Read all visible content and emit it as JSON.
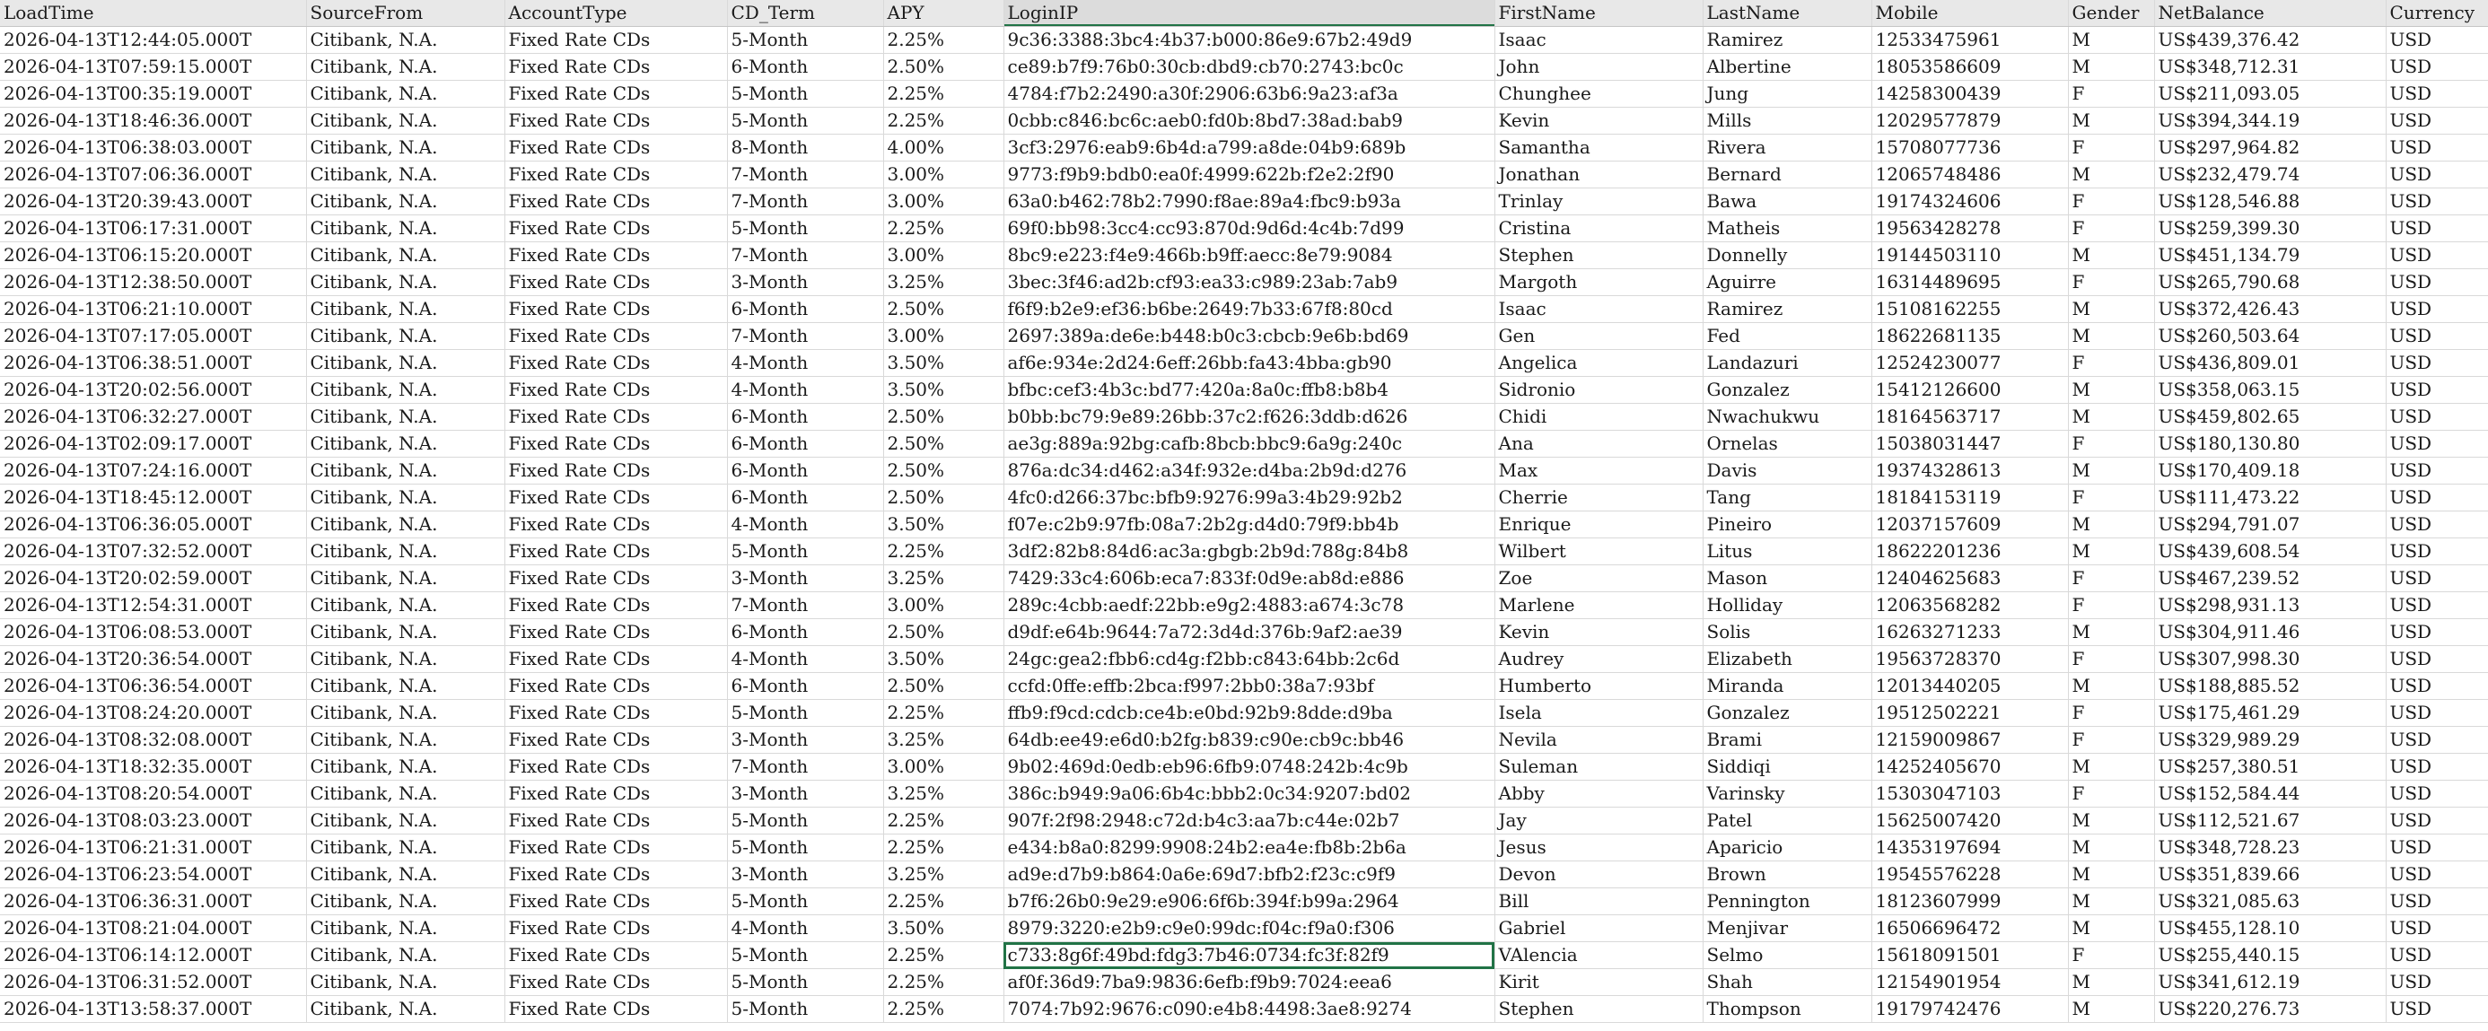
{
  "sheet": {
    "active_column": "LoginIP",
    "selected_row_index": 34,
    "columns": [
      {
        "key": "LoadTime",
        "label": "LoadTime"
      },
      {
        "key": "SourceFrom",
        "label": "SourceFrom"
      },
      {
        "key": "AccountType",
        "label": "AccountType"
      },
      {
        "key": "CD_Term",
        "label": "CD_Term"
      },
      {
        "key": "APY",
        "label": "APY"
      },
      {
        "key": "LoginIP",
        "label": "LoginIP"
      },
      {
        "key": "FirstName",
        "label": "FirstName"
      },
      {
        "key": "LastName",
        "label": "LastName"
      },
      {
        "key": "Mobile",
        "label": "Mobile"
      },
      {
        "key": "Gender",
        "label": "Gender"
      },
      {
        "key": "NetBalance",
        "label": "NetBalance"
      },
      {
        "key": "Currency",
        "label": "Currency"
      }
    ],
    "rows": [
      [
        "2026-04-13T12:44:05.000T",
        "Citibank, N.A.",
        "Fixed Rate CDs",
        "5-Month",
        "2.25%",
        "9c36:3388:3bc4:4b37:b000:86e9:67b2:49d9",
        "Isaac",
        "Ramirez",
        "12533475961",
        "M",
        "US$439,376.42",
        "USD"
      ],
      [
        "2026-04-13T07:59:15.000T",
        "Citibank, N.A.",
        "Fixed Rate CDs",
        "6-Month",
        "2.50%",
        "ce89:b7f9:76b0:30cb:dbd9:cb70:2743:bc0c",
        "John",
        "Albertine",
        "18053586609",
        "M",
        "US$348,712.31",
        "USD"
      ],
      [
        "2026-04-13T00:35:19.000T",
        "Citibank, N.A.",
        "Fixed Rate CDs",
        "5-Month",
        "2.25%",
        "4784:f7b2:2490:a30f:2906:63b6:9a23:af3a",
        "Chunghee",
        "Jung",
        "14258300439",
        "F",
        "US$211,093.05",
        "USD"
      ],
      [
        "2026-04-13T18:46:36.000T",
        "Citibank, N.A.",
        "Fixed Rate CDs",
        "5-Month",
        "2.25%",
        "0cbb:c846:bc6c:aeb0:fd0b:8bd7:38ad:bab9",
        "Kevin",
        "Mills",
        "12029577879",
        "M",
        "US$394,344.19",
        "USD"
      ],
      [
        "2026-04-13T06:38:03.000T",
        "Citibank, N.A.",
        "Fixed Rate CDs",
        "8-Month",
        "4.00%",
        "3cf3:2976:eab9:6b4d:a799:a8de:04b9:689b",
        "Samantha",
        "Rivera",
        "15708077736",
        "F",
        "US$297,964.82",
        "USD"
      ],
      [
        "2026-04-13T07:06:36.000T",
        "Citibank, N.A.",
        "Fixed Rate CDs",
        "7-Month",
        "3.00%",
        "9773:f9b9:bdb0:ea0f:4999:622b:f2e2:2f90",
        "Jonathan",
        "Bernard",
        "12065748486",
        "M",
        "US$232,479.74",
        "USD"
      ],
      [
        "2026-04-13T20:39:43.000T",
        "Citibank, N.A.",
        "Fixed Rate CDs",
        "7-Month",
        "3.00%",
        "63a0:b462:78b2:7990:f8ae:89a4:fbc9:b93a",
        "Trinlay",
        "Bawa",
        "19174324606",
        "F",
        "US$128,546.88",
        "USD"
      ],
      [
        "2026-04-13T06:17:31.000T",
        "Citibank, N.A.",
        "Fixed Rate CDs",
        "5-Month",
        "2.25%",
        "69f0:bb98:3cc4:cc93:870d:9d6d:4c4b:7d99",
        "Cristina",
        "Matheis",
        "19563428278",
        "F",
        "US$259,399.30",
        "USD"
      ],
      [
        "2026-04-13T06:15:20.000T",
        "Citibank, N.A.",
        "Fixed Rate CDs",
        "7-Month",
        "3.00%",
        "8bc9:e223:f4e9:466b:b9ff:aecc:8e79:9084",
        "Stephen",
        "Donnelly",
        "19144503110",
        "M",
        "US$451,134.79",
        "USD"
      ],
      [
        "2026-04-13T12:38:50.000T",
        "Citibank, N.A.",
        "Fixed Rate CDs",
        "3-Month",
        "3.25%",
        "3bec:3f46:ad2b:cf93:ea33:c989:23ab:7ab9",
        "Margoth",
        "Aguirre",
        "16314489695",
        "F",
        "US$265,790.68",
        "USD"
      ],
      [
        "2026-04-13T06:21:10.000T",
        "Citibank, N.A.",
        "Fixed Rate CDs",
        "6-Month",
        "2.50%",
        "f6f9:b2e9:ef36:b6be:2649:7b33:67f8:80cd",
        "Isaac",
        "Ramirez",
        "15108162255",
        "M",
        "US$372,426.43",
        "USD"
      ],
      [
        "2026-04-13T07:17:05.000T",
        "Citibank, N.A.",
        "Fixed Rate CDs",
        "7-Month",
        "3.00%",
        "2697:389a:de6e:b448:b0c3:cbcb:9e6b:bd69",
        "Gen",
        "Fed",
        "18622681135",
        "M",
        "US$260,503.64",
        "USD"
      ],
      [
        "2026-04-13T06:38:51.000T",
        "Citibank, N.A.",
        "Fixed Rate CDs",
        "4-Month",
        "3.50%",
        "af6e:934e:2d24:6eff:26bb:fa43:4bba:gb90",
        "Angelica",
        "Landazuri",
        "12524230077",
        "F",
        "US$436,809.01",
        "USD"
      ],
      [
        "2026-04-13T20:02:56.000T",
        "Citibank, N.A.",
        "Fixed Rate CDs",
        "4-Month",
        "3.50%",
        "bfbc:cef3:4b3c:bd77:420a:8a0c:ffb8:b8b4",
        "Sidronio",
        "Gonzalez",
        "15412126600",
        "M",
        "US$358,063.15",
        "USD"
      ],
      [
        "2026-04-13T06:32:27.000T",
        "Citibank, N.A.",
        "Fixed Rate CDs",
        "6-Month",
        "2.50%",
        "b0bb:bc79:9e89:26bb:37c2:f626:3ddb:d626",
        "Chidi",
        "Nwachukwu",
        "18164563717",
        "M",
        "US$459,802.65",
        "USD"
      ],
      [
        "2026-04-13T02:09:17.000T",
        "Citibank, N.A.",
        "Fixed Rate CDs",
        "6-Month",
        "2.50%",
        "ae3g:889a:92bg:cafb:8bcb:bbc9:6a9g:240c",
        "Ana",
        "Ornelas",
        "15038031447",
        "F",
        "US$180,130.80",
        "USD"
      ],
      [
        "2026-04-13T07:24:16.000T",
        "Citibank, N.A.",
        "Fixed Rate CDs",
        "6-Month",
        "2.50%",
        "876a:dc34:d462:a34f:932e:d4ba:2b9d:d276",
        "Max",
        "Davis",
        "19374328613",
        "M",
        "US$170,409.18",
        "USD"
      ],
      [
        "2026-04-13T18:45:12.000T",
        "Citibank, N.A.",
        "Fixed Rate CDs",
        "6-Month",
        "2.50%",
        "4fc0:d266:37bc:bfb9:9276:99a3:4b29:92b2",
        "Cherrie",
        "Tang",
        "18184153119",
        "F",
        "US$111,473.22",
        "USD"
      ],
      [
        "2026-04-13T06:36:05.000T",
        "Citibank, N.A.",
        "Fixed Rate CDs",
        "4-Month",
        "3.50%",
        "f07e:c2b9:97fb:08a7:2b2g:d4d0:79f9:bb4b",
        "Enrique",
        "Pineiro",
        "12037157609",
        "M",
        "US$294,791.07",
        "USD"
      ],
      [
        "2026-04-13T07:32:52.000T",
        "Citibank, N.A.",
        "Fixed Rate CDs",
        "5-Month",
        "2.25%",
        "3df2:82b8:84d6:ac3a:gbgb:2b9d:788g:84b8",
        "Wilbert",
        "Litus",
        "18622201236",
        "M",
        "US$439,608.54",
        "USD"
      ],
      [
        "2026-04-13T20:02:59.000T",
        "Citibank, N.A.",
        "Fixed Rate CDs",
        "3-Month",
        "3.25%",
        "7429:33c4:606b:eca7:833f:0d9e:ab8d:e886",
        "Zoe",
        "Mason",
        "12404625683",
        "F",
        "US$467,239.52",
        "USD"
      ],
      [
        "2026-04-13T12:54:31.000T",
        "Citibank, N.A.",
        "Fixed Rate CDs",
        "7-Month",
        "3.00%",
        "289c:4cbb:aedf:22bb:e9g2:4883:a674:3c78",
        "Marlene",
        "Holliday",
        "12063568282",
        "F",
        "US$298,931.13",
        "USD"
      ],
      [
        "2026-04-13T06:08:53.000T",
        "Citibank, N.A.",
        "Fixed Rate CDs",
        "6-Month",
        "2.50%",
        "d9df:e64b:9644:7a72:3d4d:376b:9af2:ae39",
        "Kevin",
        "Solis",
        "16263271233",
        "M",
        "US$304,911.46",
        "USD"
      ],
      [
        "2026-04-13T20:36:54.000T",
        "Citibank, N.A.",
        "Fixed Rate CDs",
        "4-Month",
        "3.50%",
        "24gc:gea2:fbb6:cd4g:f2bb:c843:64bb:2c6d",
        "Audrey",
        "Elizabeth",
        "19563728370",
        "F",
        "US$307,998.30",
        "USD"
      ],
      [
        "2026-04-13T06:36:54.000T",
        "Citibank, N.A.",
        "Fixed Rate CDs",
        "6-Month",
        "2.50%",
        "ccfd:0ffe:effb:2bca:f997:2bb0:38a7:93bf",
        "Humberto",
        "Miranda",
        "12013440205",
        "M",
        "US$188,885.52",
        "USD"
      ],
      [
        "2026-04-13T08:24:20.000T",
        "Citibank, N.A.",
        "Fixed Rate CDs",
        "5-Month",
        "2.25%",
        "ffb9:f9cd:cdcb:ce4b:e0bd:92b9:8dde:d9ba",
        "Isela",
        "Gonzalez",
        "19512502221",
        "F",
        "US$175,461.29",
        "USD"
      ],
      [
        "2026-04-13T08:32:08.000T",
        "Citibank, N.A.",
        "Fixed Rate CDs",
        "3-Month",
        "3.25%",
        "64db:ee49:e6d0:b2fg:b839:c90e:cb9c:bb46",
        "Nevila",
        "Brami",
        "12159009867",
        "F",
        "US$329,989.29",
        "USD"
      ],
      [
        "2026-04-13T18:32:35.000T",
        "Citibank, N.A.",
        "Fixed Rate CDs",
        "7-Month",
        "3.00%",
        "9b02:469d:0edb:eb96:6fb9:0748:242b:4c9b",
        "Suleman",
        "Siddiqi",
        "14252405670",
        "M",
        "US$257,380.51",
        "USD"
      ],
      [
        "2026-04-13T08:20:54.000T",
        "Citibank, N.A.",
        "Fixed Rate CDs",
        "3-Month",
        "3.25%",
        "386c:b949:9a06:6b4c:bbb2:0c34:9207:bd02",
        "Abby",
        "Varinsky",
        "15303047103",
        "F",
        "US$152,584.44",
        "USD"
      ],
      [
        "2026-04-13T08:03:23.000T",
        "Citibank, N.A.",
        "Fixed Rate CDs",
        "5-Month",
        "2.25%",
        "907f:2f98:2948:c72d:b4c3:aa7b:c44e:02b7",
        "Jay",
        "Patel",
        "15625007420",
        "M",
        "US$112,521.67",
        "USD"
      ],
      [
        "2026-04-13T06:21:31.000T",
        "Citibank, N.A.",
        "Fixed Rate CDs",
        "5-Month",
        "2.25%",
        "e434:b8a0:8299:9908:24b2:ea4e:fb8b:2b6a",
        "Jesus",
        "Aparicio",
        "14353197694",
        "M",
        "US$348,728.23",
        "USD"
      ],
      [
        "2026-04-13T06:23:54.000T",
        "Citibank, N.A.",
        "Fixed Rate CDs",
        "3-Month",
        "3.25%",
        "ad9e:d7b9:b864:0a6e:69d7:bfb2:f23c:c9f9",
        "Devon",
        "Brown",
        "19545576228",
        "M",
        "US$351,839.66",
        "USD"
      ],
      [
        "2026-04-13T06:36:31.000T",
        "Citibank, N.A.",
        "Fixed Rate CDs",
        "5-Month",
        "2.25%",
        "b7f6:26b0:9e29:e906:6f6b:394f:b99a:2964",
        "Bill",
        "Pennington",
        "18123607999",
        "M",
        "US$321,085.63",
        "USD"
      ],
      [
        "2026-04-13T08:21:04.000T",
        "Citibank, N.A.",
        "Fixed Rate CDs",
        "4-Month",
        "3.50%",
        "8979:3220:e2b9:c9e0:99dc:f04c:f9a0:f306",
        "Gabriel",
        "Menjivar",
        "16506696472",
        "M",
        "US$455,128.10",
        "USD"
      ],
      [
        "2026-04-13T06:14:12.000T",
        "Citibank, N.A.",
        "Fixed Rate CDs",
        "5-Month",
        "2.25%",
        "c733:8g6f:49bd:fdg3:7b46:0734:fc3f:82f9",
        "VAlencia",
        "Selmo",
        "15618091501",
        "F",
        "US$255,440.15",
        "USD"
      ],
      [
        "2026-04-13T06:31:52.000T",
        "Citibank, N.A.",
        "Fixed Rate CDs",
        "5-Month",
        "2.25%",
        "af0f:36d9:7ba9:9836:6efb:f9b9:7024:eea6",
        "Kirit",
        "Shah",
        "12154901954",
        "M",
        "US$341,612.19",
        "USD"
      ],
      [
        "2026-04-13T13:58:37.000T",
        "Citibank, N.A.",
        "Fixed Rate CDs",
        "5-Month",
        "2.25%",
        "7074:7b92:9676:c090:e4b8:4498:3ae8:9274",
        "Stephen",
        "Thompson",
        "19179742476",
        "M",
        "US$220,276.73",
        "USD"
      ]
    ]
  }
}
